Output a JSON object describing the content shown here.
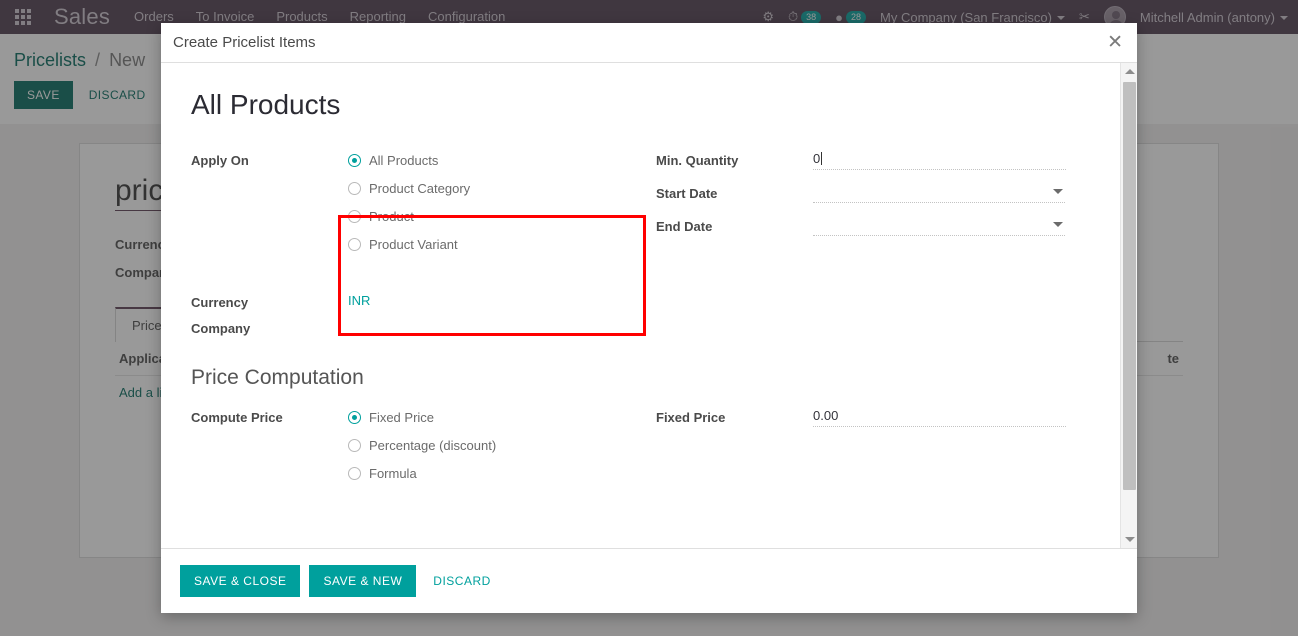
{
  "topbar": {
    "apps_icon": "apps-grid-icon",
    "brand": "Sales",
    "nav": [
      {
        "label": "Orders"
      },
      {
        "label": "To Invoice"
      },
      {
        "label": "Products"
      },
      {
        "label": "Reporting"
      },
      {
        "label": "Configuration"
      }
    ],
    "bug_icon": "bug-icon",
    "activity_icon": "clock-icon",
    "activity_count": "38",
    "messages_icon": "chat-icon",
    "messages_count": "28",
    "company": "My Company (San Francisco)",
    "shortcut_icon": "scissors-icon",
    "user": "Mitchell Admin (antony)"
  },
  "breadcrumb": {
    "root": "Pricelists",
    "separator": "/",
    "current": "New",
    "save_label": "SAVE",
    "discard_label": "DISCARD"
  },
  "background_sheet": {
    "title": "pric",
    "currency_label": "Currency",
    "company_label": "Company",
    "tab_label": "Price R",
    "col_applicable": "Applicab",
    "col_date": "te",
    "add_line": "Add a lin"
  },
  "modal": {
    "title": "Create Pricelist Items",
    "close_icon": "close-icon",
    "form_title": "All Products",
    "apply_on": {
      "label": "Apply On",
      "options": [
        {
          "label": "All Products",
          "checked": true
        },
        {
          "label": "Product Category",
          "checked": false
        },
        {
          "label": "Product",
          "checked": false
        },
        {
          "label": "Product Variant",
          "checked": false
        }
      ]
    },
    "min_quantity": {
      "label": "Min. Quantity",
      "value": "0"
    },
    "start_date": {
      "label": "Start Date",
      "value": ""
    },
    "end_date": {
      "label": "End Date",
      "value": ""
    },
    "currency": {
      "label": "Currency",
      "value": "INR"
    },
    "company": {
      "label": "Company",
      "value": ""
    },
    "price_computation": {
      "section_title": "Price Computation",
      "compute_price_label": "Compute Price",
      "options": [
        {
          "label": "Fixed Price",
          "checked": true
        },
        {
          "label": "Percentage (discount)",
          "checked": false
        },
        {
          "label": "Formula",
          "checked": false
        }
      ],
      "fixed_price": {
        "label": "Fixed Price",
        "value": "0.00"
      }
    },
    "footer": {
      "save_close": "SAVE & CLOSE",
      "save_new": "SAVE & NEW",
      "discard": "DISCARD"
    },
    "scrollbar": {
      "up_icon": "scroll-up-arrow-icon",
      "down_icon": "scroll-down-arrow-icon"
    }
  },
  "colors": {
    "accent": "#00a09d",
    "topbar": "#4c3b4d",
    "highlight": "#ff0000",
    "save_dark": "#00695c"
  }
}
